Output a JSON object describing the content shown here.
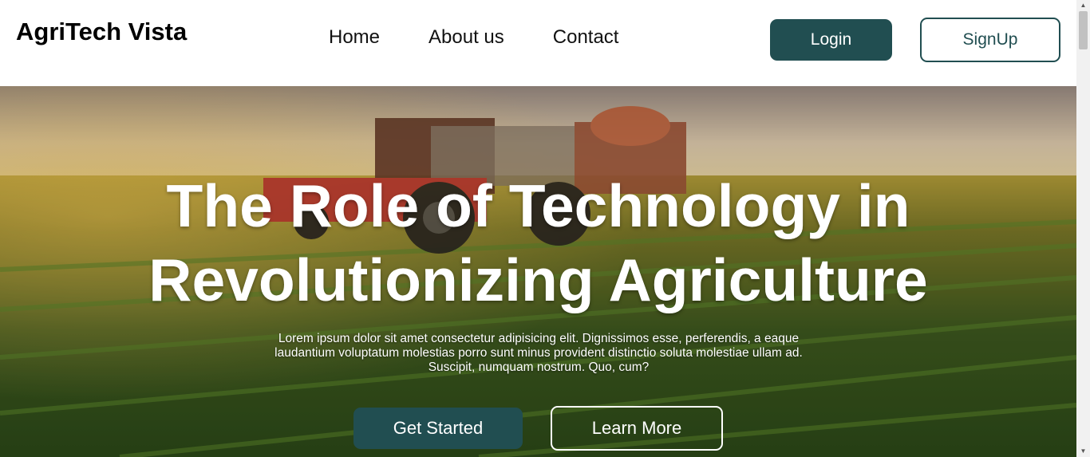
{
  "navbar": {
    "brand": "AgriTech Vista",
    "links": [
      {
        "label": "Home"
      },
      {
        "label": "About us"
      },
      {
        "label": "Contact"
      }
    ],
    "login_label": "Login",
    "signup_label": "SignUp"
  },
  "hero": {
    "title_line1": "The Role of Technology in",
    "title_line2": "Revolutionizing Agriculture",
    "description": "Lorem ipsum dolor sit amet consectetur adipisicing elit. Dignissimos esse, perferendis, a eaque laudantium voluptatum molestias porro sunt minus provident distinctio soluta molestiae ullam ad. Suscipit, numquam nostrum. Quo, cum?",
    "primary_button": "Get Started",
    "secondary_button": "Learn More"
  },
  "colors": {
    "accent": "#214e51",
    "background": "#ffffff",
    "hero_text": "#ffffff"
  },
  "icons": {
    "scroll_up": "arrow-up-icon",
    "scroll_down": "arrow-down-icon"
  }
}
